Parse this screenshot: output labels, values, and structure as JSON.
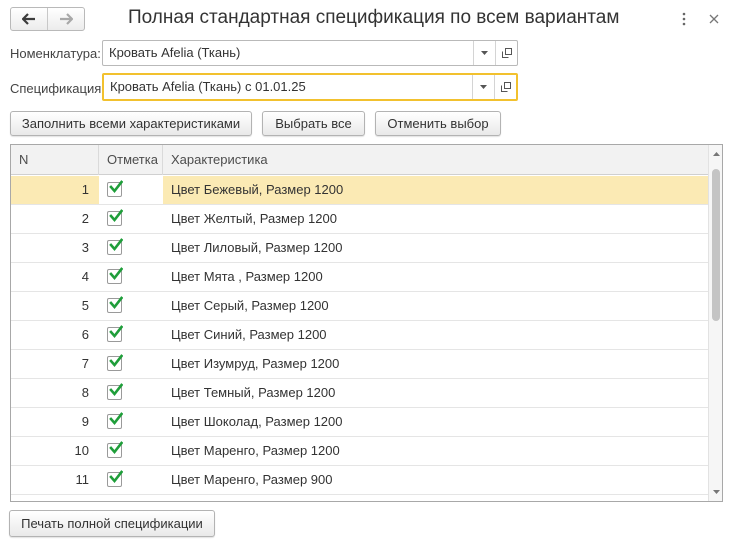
{
  "header": {
    "title": "Полная стандартная спецификация по всем вариантам",
    "back_icon": "arrow-left-icon",
    "forward_icon": "arrow-right-icon",
    "more_icon": "more-vertical-icon",
    "close_icon": "close-icon"
  },
  "fields": {
    "nomenclature": {
      "label": "Номенклатура:",
      "value": "Кровать Afelia (Ткань)"
    },
    "specification": {
      "label": "Спецификация:",
      "value": "Кровать Afelia (Ткань) с 01.01.25"
    }
  },
  "buttons": {
    "fill_all": "Заполнить всеми характеристиками",
    "select_all": "Выбрать все",
    "cancel_selection": "Отменить выбор",
    "print": "Печать полной спецификации"
  },
  "table": {
    "columns": [
      "N",
      "Отметка",
      "Характеристика"
    ],
    "rows": [
      {
        "n": "1",
        "checked": true,
        "characteristic": "Цвет Бежевый, Размер 1200"
      },
      {
        "n": "2",
        "checked": true,
        "characteristic": "Цвет Желтый, Размер 1200"
      },
      {
        "n": "3",
        "checked": true,
        "characteristic": "Цвет Лиловый, Размер 1200"
      },
      {
        "n": "4",
        "checked": true,
        "characteristic": "Цвет Мята , Размер 1200"
      },
      {
        "n": "5",
        "checked": true,
        "characteristic": "Цвет Серый, Размер 1200"
      },
      {
        "n": "6",
        "checked": true,
        "characteristic": "Цвет Синий, Размер 1200"
      },
      {
        "n": "7",
        "checked": true,
        "characteristic": "Цвет Изумруд, Размер 1200"
      },
      {
        "n": "8",
        "checked": true,
        "characteristic": "Цвет Темный, Размер 1200"
      },
      {
        "n": "9",
        "checked": true,
        "characteristic": "Цвет Шоколад, Размер 1200"
      },
      {
        "n": "10",
        "checked": true,
        "characteristic": "Цвет Маренго, Размер 1200"
      },
      {
        "n": "11",
        "checked": true,
        "characteristic": "Цвет Маренго, Размер 900"
      }
    ],
    "selected_row": 1
  },
  "colors": {
    "selected_row": "#fbeab4",
    "focus_border": "#f2c12e",
    "check": "#1f9e3a"
  }
}
